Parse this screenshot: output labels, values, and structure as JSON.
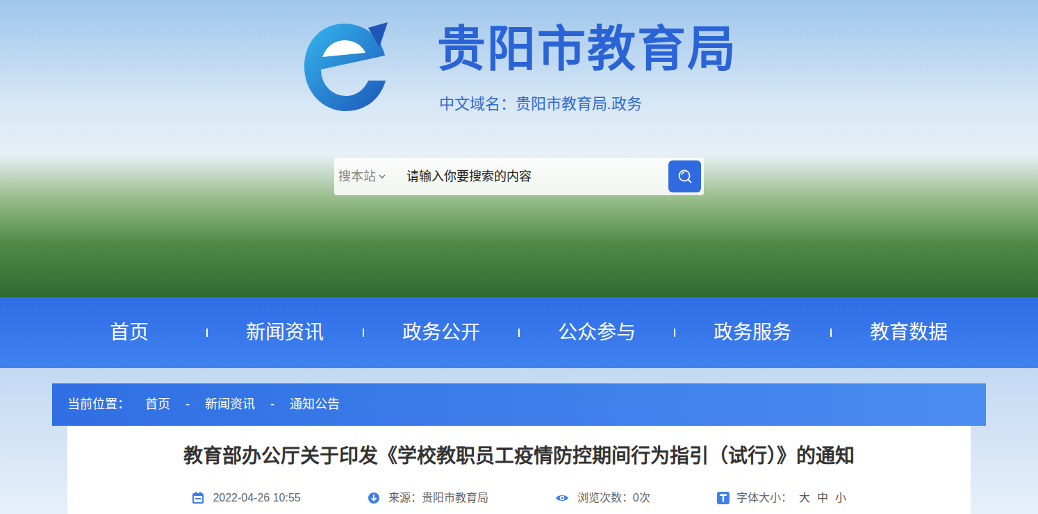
{
  "header": {
    "title": "贵阳市教育局",
    "domain": "中文域名：贵阳市教育局.政务"
  },
  "search": {
    "scope": "搜本站",
    "placeholder": "请输入你要搜索的内容"
  },
  "nav": [
    {
      "label": "首页"
    },
    {
      "label": "新闻资讯"
    },
    {
      "label": "政务公开"
    },
    {
      "label": "公众参与"
    },
    {
      "label": "政务服务"
    },
    {
      "label": "教育数据"
    }
  ],
  "breadcrumb": {
    "label": "当前位置：",
    "items": [
      "首页",
      "新闻资讯",
      "通知公告"
    ],
    "separator": "-"
  },
  "article": {
    "title": "教育部办公厅关于印发《学校教职员工疫情防控期间行为指引（试行）》的通知",
    "meta": {
      "date": "2022-04-26 10:55",
      "source": "来源：贵阳市教育局",
      "views": "浏览次数：0次",
      "font_size": {
        "label": "字体大小：",
        "options": [
          "大",
          "中",
          "小"
        ]
      }
    }
  }
}
